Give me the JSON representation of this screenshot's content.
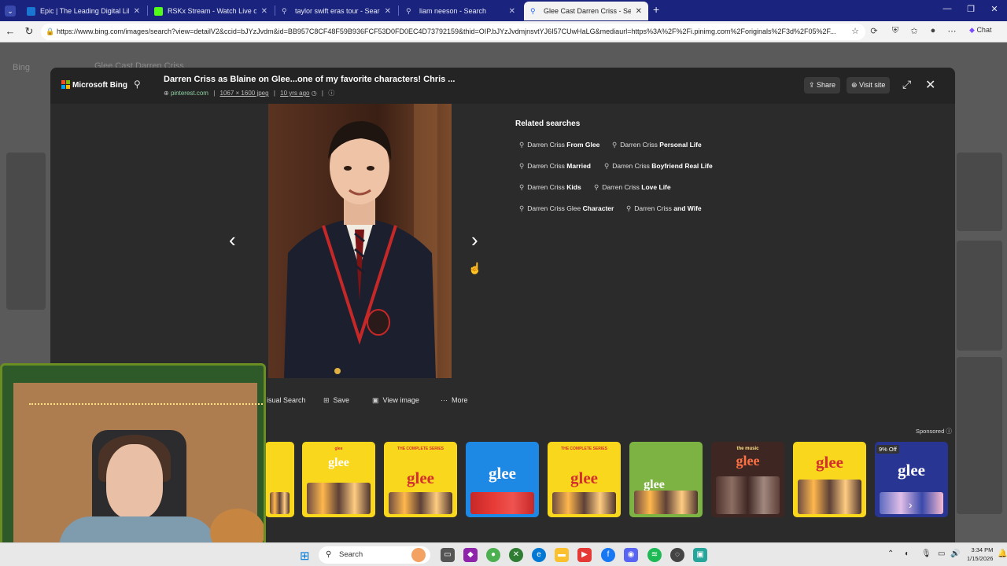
{
  "browser": {
    "tabs": [
      {
        "title": "Epic | The Leading Digital Library f",
        "fav_color": "#1976d2"
      },
      {
        "title": "RSKx Stream - Watch Live on Kick",
        "fav_color": "#53fc18"
      },
      {
        "title": "taylor swift eras tour - Search",
        "fav_color": "#5c6bc0"
      },
      {
        "title": "liam neeson - Search",
        "fav_color": "#5c6bc0"
      },
      {
        "title": "Glee Cast Darren Criss - Search Im",
        "fav_color": "#2962ff"
      }
    ],
    "new_tab": "+",
    "url": "https://www.bing.com/images/search?view=detailV2&ccid=bJYzJvdm&id=BB957C8CF48F59B936FCF53D0FD0EC4D73792159&thid=OIP.bJYzJvdmjnsvtYJ6I57CUwHaLG&mediaurl=https%3A%2F%2Fi.pinimg.com%2Foriginals%2F3d%2F05%2F...",
    "chat_label": "Chat"
  },
  "background_page": {
    "brand": "Bing",
    "query": "Glee Cast Darren Criss"
  },
  "modal": {
    "brand": "Microsoft Bing",
    "title": "Darren Criss as Blaine on Glee...one of my favorite characters! Chris ...",
    "meta": {
      "source": "pinterest.com",
      "size": "1067 × 1600 jpeg",
      "age": "10 yrs ago"
    },
    "share_label": "Share",
    "visit_label": "Visit site",
    "related_title": "Related searches",
    "related": [
      {
        "pre": "Darren Criss ",
        "bold": "From Glee"
      },
      {
        "pre": "Darren Criss ",
        "bold": "Personal Life"
      },
      {
        "pre": "Darren Criss ",
        "bold": "Married"
      },
      {
        "pre": "Darren Criss ",
        "bold": "Boyfriend Real Life"
      },
      {
        "pre": "Darren Criss ",
        "bold": "Kids"
      },
      {
        "pre": "Darren Criss ",
        "bold": "Love Life"
      },
      {
        "pre": "Darren Criss Glee ",
        "bold": "Character"
      },
      {
        "pre": "Darren Criss ",
        "bold": "and Wife"
      }
    ],
    "actions": {
      "visual_search": "isual Search",
      "save": "Save",
      "view_image": "View image",
      "more": "More"
    },
    "sponsored": "Sponsored",
    "products": [
      {
        "label": "",
        "top": ""
      },
      {
        "label": "glee",
        "top": "glee"
      },
      {
        "label": "glee",
        "top": "THE COMPLETE SERIES"
      },
      {
        "label": "glee",
        "top": ""
      },
      {
        "label": "glee",
        "top": "THE COMPLETE SERIES"
      },
      {
        "label": "glee",
        "top": ""
      },
      {
        "label": "glee",
        "top": "the music"
      },
      {
        "label": "glee",
        "top": ""
      },
      {
        "label": "glee",
        "top": "9% Off"
      }
    ],
    "discount_badge": "9% Off"
  },
  "taskbar": {
    "search_label": "Search",
    "time": "3:34 PM",
    "date": "1/15/2026"
  },
  "colors": {
    "tabbar": "#1a237e",
    "modal_bg": "#2b2b2b",
    "glee_red": "#d32f2f",
    "glee_yellow": "#f9d71c"
  }
}
